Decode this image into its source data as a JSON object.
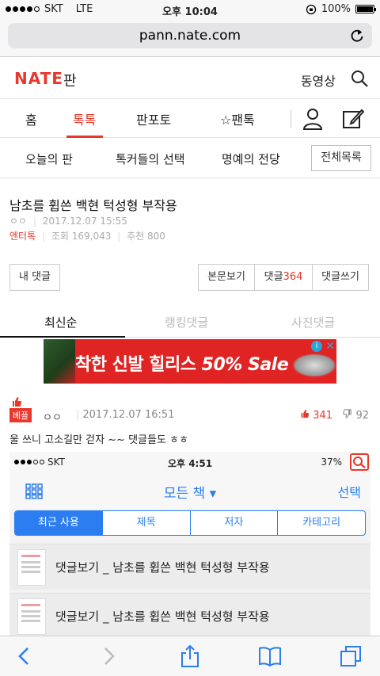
{
  "status_bar": {
    "carrier": "SKT",
    "network": "LTE",
    "time": "오후 10:04",
    "battery": "100%"
  },
  "browser": {
    "url": "pann.nate.com"
  },
  "header": {
    "logo": "NATE",
    "section": "판",
    "video_link": "동영상"
  },
  "tabs": {
    "home": "홈",
    "talk": "톡톡",
    "photo": "판포토",
    "fantalk": "☆팬톡"
  },
  "submenu": {
    "today": "오늘의 판",
    "choice": "톡커들의 선택",
    "hall": "명예의 전당",
    "all_list": "전체목록"
  },
  "article": {
    "title": "남초를 휩쓴 백현 턱성형 부작용",
    "author": "ㅇㅇ",
    "date": "2017.12.07 15:55",
    "category": "엔터톡",
    "views_label": "조회",
    "views": "169,043",
    "recommend_label": "추천",
    "recommend": "800"
  },
  "comment_actions": {
    "my_comments": "내 댓글",
    "view_body": "본문보기",
    "comments_label": "댓글",
    "comments_count": "364",
    "write_comment": "댓글쓰기"
  },
  "sort_tabs": {
    "latest": "최신순",
    "ranking": "랭킹댓글",
    "photo": "사진댓글"
  },
  "ad": {
    "text_main": "착한 신발 힐리스",
    "text_sale": "50% Sale",
    "info": "i",
    "close": "✕"
  },
  "comment": {
    "best_label": "베플",
    "author": "ㅇㅇ",
    "time": "2017.12.07 16:51",
    "likes": "341",
    "dislikes": "92",
    "text": "울 쓰니 고소길만 걷자 ~~ 댓글들도 ㅎㅎ"
  },
  "embedded_screenshot": {
    "carrier": "SKT",
    "time": "오후 4:51",
    "battery": "37%",
    "title": "모든 책 ▾",
    "select": "선택",
    "segments": [
      "최근 사용",
      "제목",
      "저자",
      "카테고리"
    ],
    "rows": [
      "댓글보기 _ 남초를 휩쓴 백현 턱성형 부작용",
      "댓글보기 _ 남초를 휩쓴 백현 턱성형 부작용"
    ]
  },
  "colors": {
    "brand": "#e8382b",
    "ios_blue": "#2b7df0"
  }
}
